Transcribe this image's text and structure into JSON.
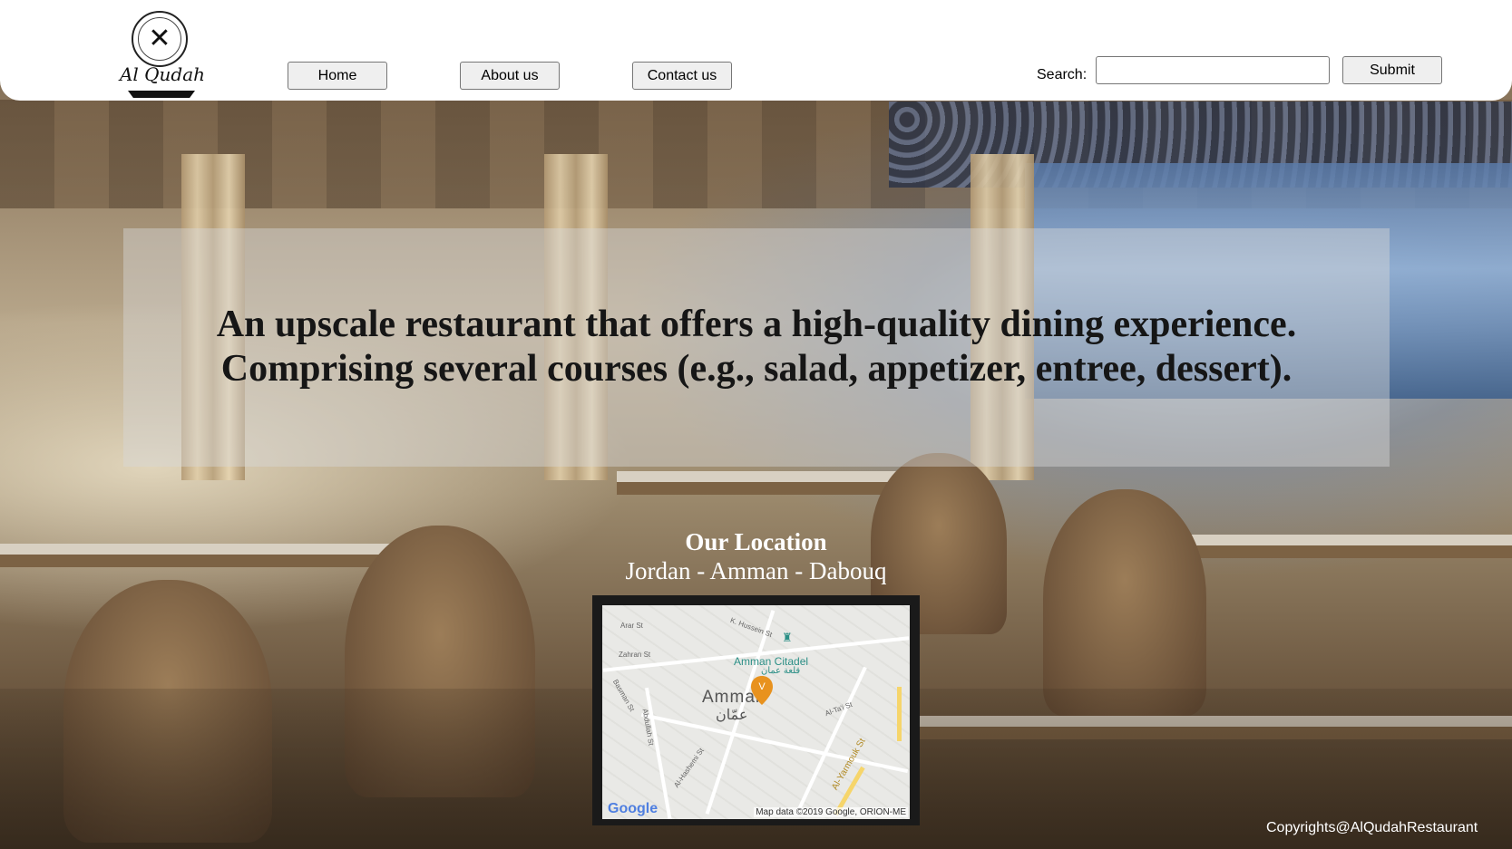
{
  "header": {
    "logo": {
      "script_text": "Al Qudah"
    },
    "nav": [
      {
        "label": "Home"
      },
      {
        "label": "About us"
      },
      {
        "label": "Contact us"
      }
    ],
    "search": {
      "label": "Search:",
      "value": "",
      "placeholder": ""
    },
    "submit_label": "Submit"
  },
  "hero": {
    "line1": "An upscale restaurant that offers a high-quality dining experience.",
    "line2": "Comprising several courses (e.g., salad, appetizer, entree, dessert)."
  },
  "location": {
    "title": "Our Location",
    "subtitle": "Jordan - Amman - Dabouq",
    "map": {
      "city_en": "Amman",
      "city_ar": "عمّان",
      "landmark": "Amman Citadel",
      "landmark_ar": "قلعة عمان",
      "streets": [
        "Arar St",
        "K. Hussein St",
        "Zahran St",
        "Al-Yarmouk St",
        "Al-Hashemi St",
        "Abdullah St",
        "Basman St",
        "Al-Ta'i St"
      ],
      "brand": "Google",
      "attribution": "Map data ©2019 Google, ORION-ME"
    }
  },
  "footer": {
    "copyright": "Copyrights@AlQudahRestaurant"
  },
  "colors": {
    "header_bg": "#ffffff",
    "button_bg": "#efefef",
    "hero_text": "#161616",
    "map_pin": "#e8921e",
    "landmark": "#2b8f86"
  }
}
